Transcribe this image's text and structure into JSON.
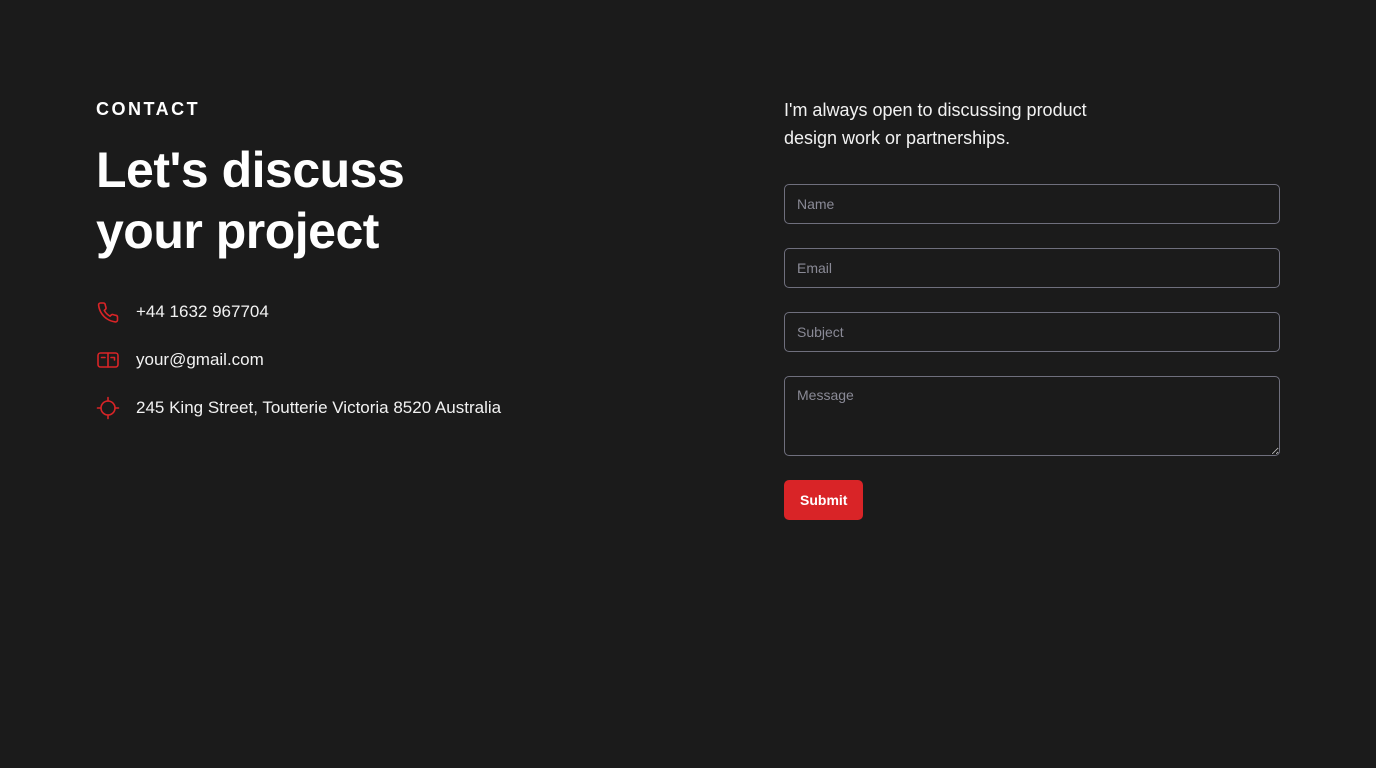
{
  "contact": {
    "eyebrow": "CONTACT",
    "heading": "Let's discuss your project",
    "items": [
      {
        "icon": "phone-icon",
        "text": "+44 1632 967704"
      },
      {
        "icon": "mail-icon",
        "text": "your@gmail.com"
      },
      {
        "icon": "location-icon",
        "text": "245 King Street, Toutterie Victoria 8520 Australia"
      }
    ]
  },
  "form": {
    "intro": "I'm always open to discussing product design work or partnerships.",
    "name_placeholder": "Name",
    "email_placeholder": "Email",
    "subject_placeholder": "Subject",
    "message_placeholder": "Message",
    "submit_label": "Submit"
  },
  "colors": {
    "background": "#1b1b1b",
    "accent": "#d92427",
    "border": "#6f6f7d"
  }
}
